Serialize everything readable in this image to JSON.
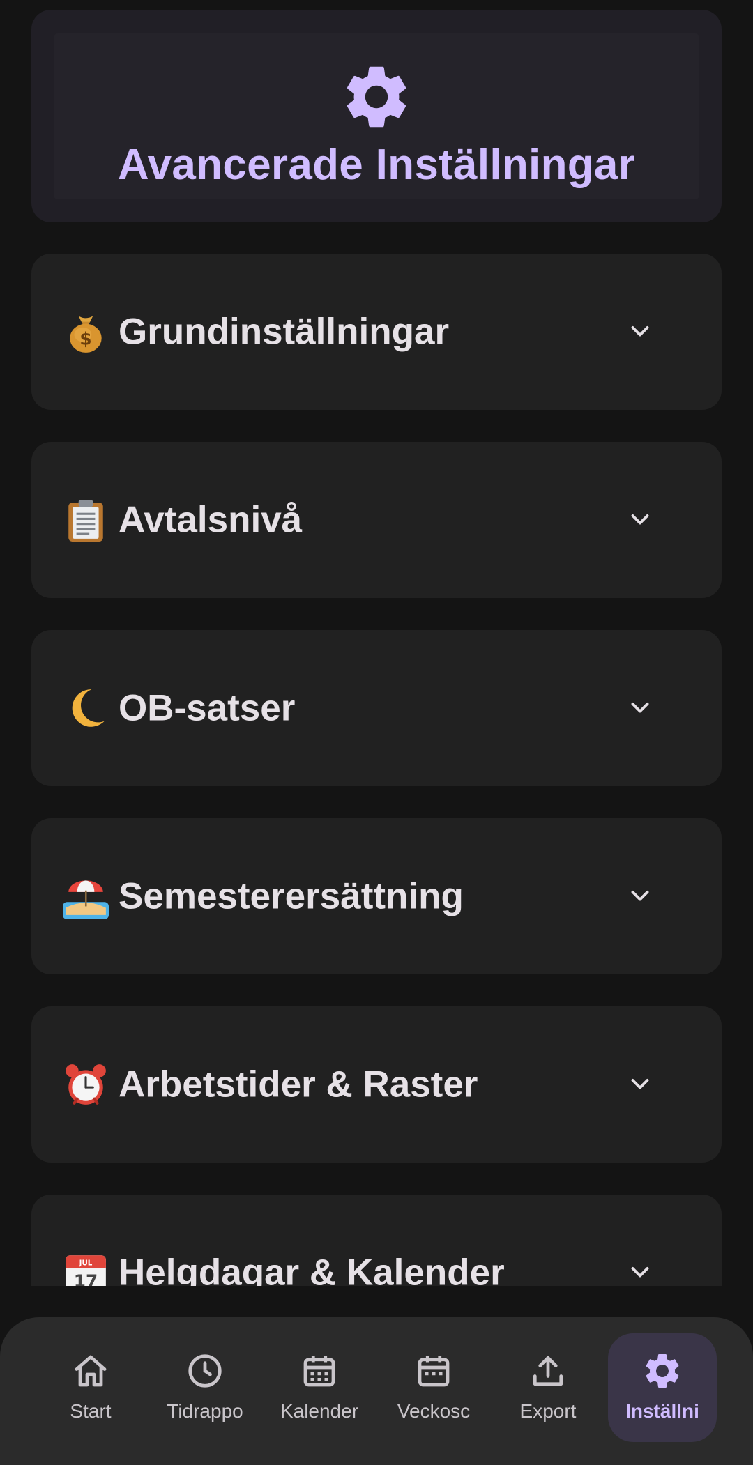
{
  "header": {
    "icon": "gear-icon",
    "title": "Avancerade Inställningar",
    "accent_color": "#d0bcff"
  },
  "sections": [
    {
      "emoji": "money-bag-icon",
      "label": "Grundinställningar"
    },
    {
      "emoji": "clipboard-icon",
      "label": "Avtalsnivå"
    },
    {
      "emoji": "crescent-moon-icon",
      "label": "OB-satser"
    },
    {
      "emoji": "beach-umbrella-icon",
      "label": "Semesterersättning"
    },
    {
      "emoji": "alarm-clock-icon",
      "label": "Arbetstider & Raster"
    },
    {
      "emoji": "calendar-icon",
      "label": "Helgdagar & Kalender"
    }
  ],
  "nav": {
    "items": [
      {
        "icon": "home-icon",
        "label": "Start"
      },
      {
        "icon": "clock-icon",
        "label": "Tidrappo"
      },
      {
        "icon": "calendar-grid-icon",
        "label": "Kalender"
      },
      {
        "icon": "calendar-week-icon",
        "label": "Veckosc"
      },
      {
        "icon": "upload-icon",
        "label": "Export"
      },
      {
        "icon": "gear-icon",
        "label": "Inställni"
      }
    ],
    "active_index": 5
  }
}
